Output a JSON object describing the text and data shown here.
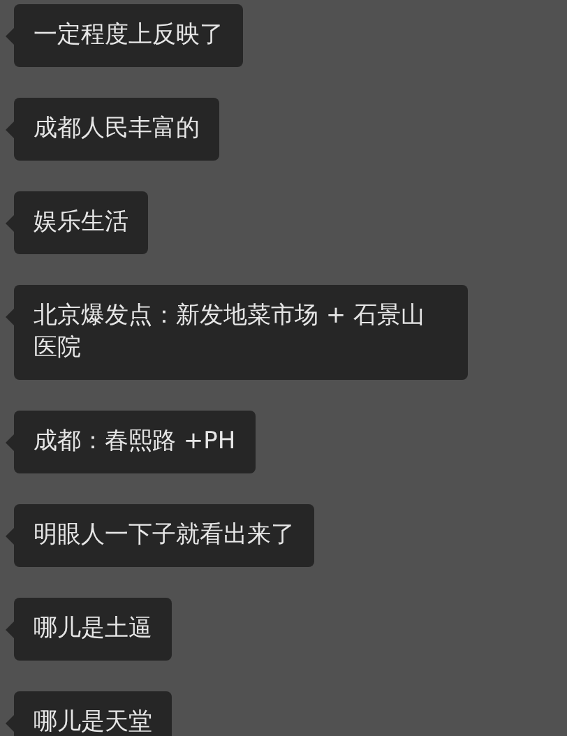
{
  "messages": [
    {
      "text": "一定程度上反映了"
    },
    {
      "text": "成都人民丰富的"
    },
    {
      "text": "娱乐生活"
    },
    {
      "text": "北京爆发点：新发地菜市场 + 石景山医院"
    },
    {
      "text": "成都：春熙路 +PH"
    },
    {
      "text": "明眼人一下子就看出来了"
    },
    {
      "text": "哪儿是土逼"
    },
    {
      "text": "哪儿是天堂"
    }
  ]
}
